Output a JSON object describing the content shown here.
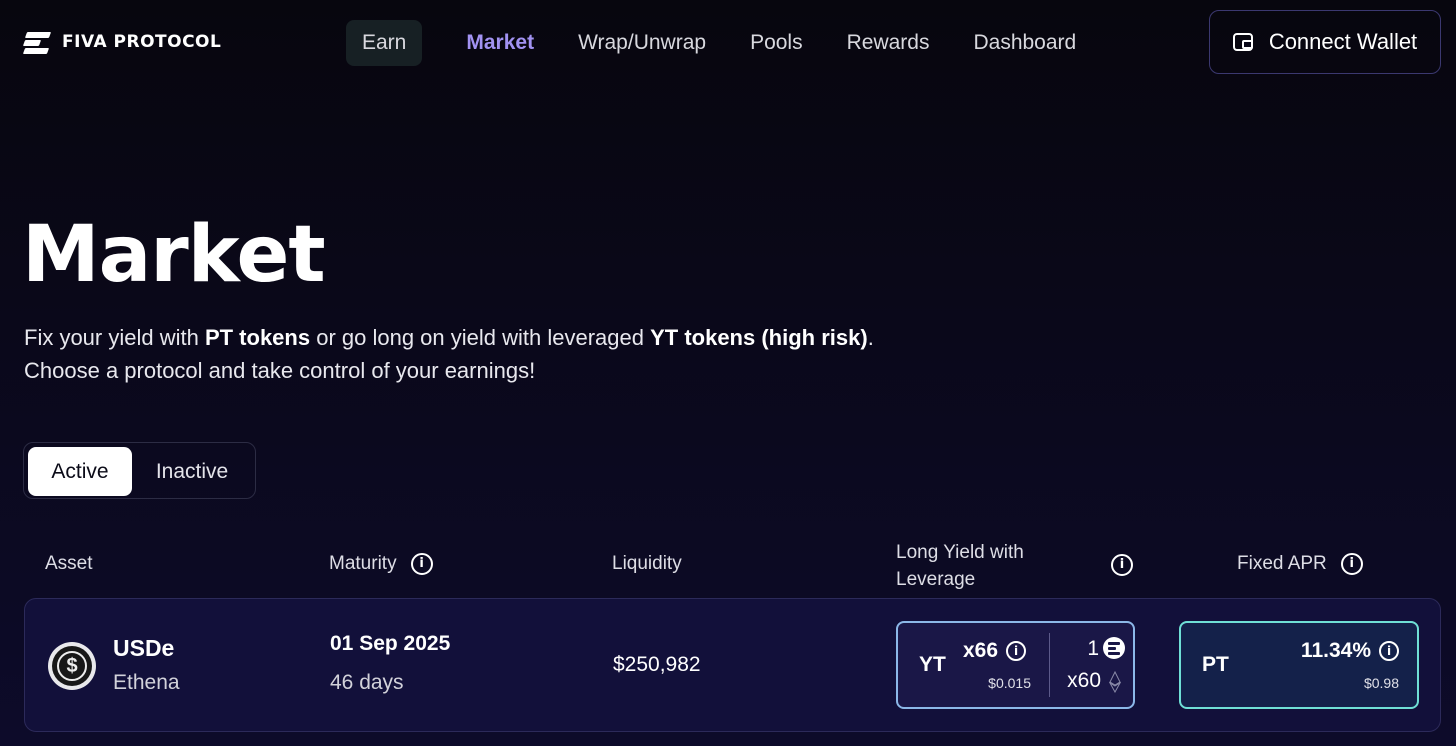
{
  "brand": {
    "name": "FIVA PROTOCOL"
  },
  "nav": {
    "items": [
      {
        "label": "Earn"
      },
      {
        "label": "Market"
      },
      {
        "label": "Wrap/Unwrap"
      },
      {
        "label": "Pools"
      },
      {
        "label": "Rewards"
      },
      {
        "label": "Dashboard"
      }
    ],
    "active": "Market"
  },
  "connect_wallet": {
    "label": "Connect Wallet",
    "icon": "wallet-icon"
  },
  "hero": {
    "title": "Market",
    "line1_pre": "Fix your yield with ",
    "line1_pt": "PT tokens",
    "line1_mid": " or go long on yield with leveraged ",
    "line1_yt": "YT tokens (high risk)",
    "line1_end": ".",
    "line2": "Choose a protocol and take control of your earnings!"
  },
  "filter": {
    "active_label": "Active",
    "inactive_label": "Inactive",
    "selected": "Active"
  },
  "table": {
    "headers": {
      "asset": "Asset",
      "maturity": "Maturity",
      "liquidity": "Liquidity",
      "long_yield_line1": "Long Yield with",
      "long_yield_line2": "Leverage",
      "fixed_apr": "Fixed APR"
    },
    "rows": [
      {
        "asset": "USDe",
        "protocol": "Ethena",
        "maturity_date": "01 Sep 2025",
        "maturity_days": "46 days",
        "liquidity": "$250,982",
        "yt": {
          "label": "YT",
          "leverage": "x66",
          "price": "$0.015",
          "points_amount": "1",
          "points_multiplier": "x60"
        },
        "pt": {
          "label": "PT",
          "apr": "11.34%",
          "price": "$0.98"
        }
      }
    ]
  },
  "colors": {
    "accent": "#a292f2",
    "yt_border": "#8cb8e8",
    "pt_border": "#6fe0d6",
    "row_bg": "#12103a"
  }
}
